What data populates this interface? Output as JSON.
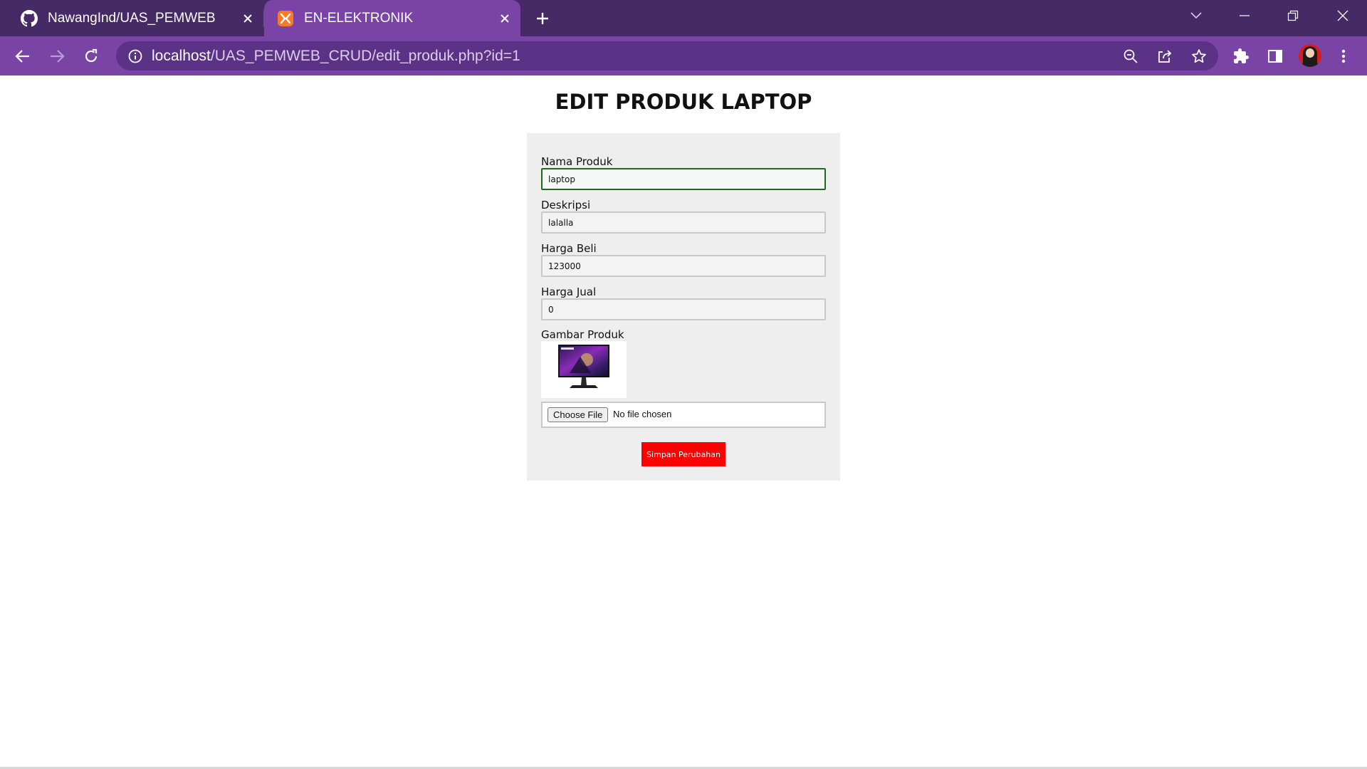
{
  "browser": {
    "tabs": [
      {
        "title": "NawangInd/UAS_PEMWEB",
        "icon": "github-icon",
        "active": false
      },
      {
        "title": "EN-ELEKTRONIK",
        "icon": "xampp-icon",
        "active": true
      }
    ],
    "url": {
      "host": "localhost",
      "path": "/UAS_PEMWEB_CRUD/edit_produk.php?id=1"
    },
    "colors": {
      "tabbar": "#452a66",
      "toolbar": "#7a43a6",
      "omnibox": "#5c3287"
    }
  },
  "page": {
    "title": "EDIT PRODUK LAPTOP",
    "fields": {
      "nama": {
        "label": "Nama Produk",
        "value": "laptop"
      },
      "deskripsi": {
        "label": "Deskripsi",
        "value": "lalalla"
      },
      "harga_beli": {
        "label": "Harga Beli",
        "value": "123000"
      },
      "harga_jual": {
        "label": "Harga Jual",
        "value": "0"
      },
      "gambar": {
        "label": "Gambar Produk",
        "image": "monitor-product-image"
      }
    },
    "file_input": {
      "button_label": "Choose File",
      "status": "No file chosen"
    },
    "submit_label": "Simpan Perubahan",
    "colors": {
      "card_bg": "#eeeeee",
      "submit_bg": "#ff0000",
      "focus_border": "#1c6b1c"
    }
  }
}
